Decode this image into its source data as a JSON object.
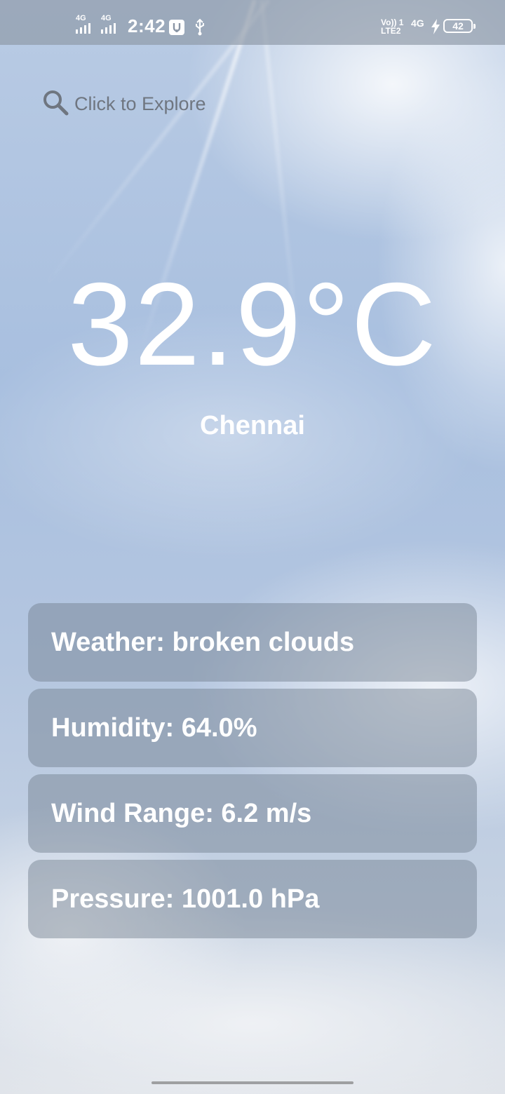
{
  "status_bar": {
    "time": "2:42",
    "sim1_network": "4G",
    "sim2_network": "4G",
    "volte_line1": "Vo)) 1",
    "volte_line2": "LTE2",
    "data_network": "4G",
    "battery_level": "42",
    "icons": [
      "signal-icon",
      "signal-icon",
      "usb-debug-icon",
      "usb-icon",
      "charging-icon",
      "battery-icon"
    ]
  },
  "search": {
    "placeholder": "Click to Explore",
    "icon": "search-icon"
  },
  "weather": {
    "temperature": "32.9°C",
    "city": "Chennai"
  },
  "details": [
    {
      "text": "Weather: broken clouds"
    },
    {
      "text": "Humidity: 64.0%"
    },
    {
      "text": "Wind Range: 6.2 m/s"
    },
    {
      "text": "Pressure: 1001.0 hPa"
    }
  ],
  "colors": {
    "text_primary": "#ffffff",
    "search_text": "#6f7680",
    "card_bg": "rgba(110,125,140,0.45)",
    "sky": "#a8bfdf"
  }
}
